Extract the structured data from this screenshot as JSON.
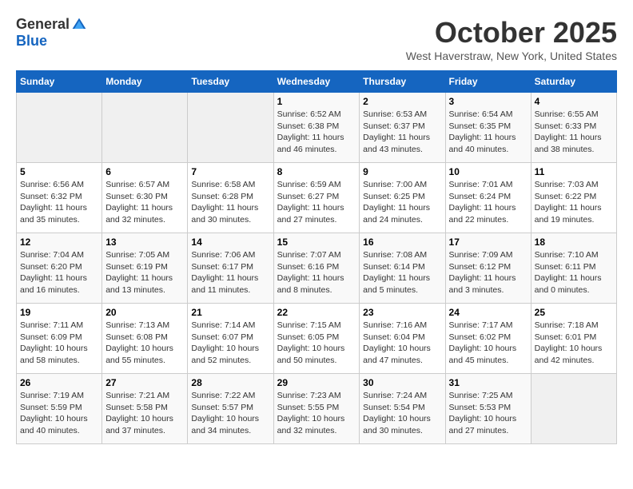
{
  "logo": {
    "general": "General",
    "blue": "Blue"
  },
  "title": "October 2025",
  "location": "West Haverstraw, New York, United States",
  "weekdays": [
    "Sunday",
    "Monday",
    "Tuesday",
    "Wednesday",
    "Thursday",
    "Friday",
    "Saturday"
  ],
  "weeks": [
    [
      {
        "day": "",
        "info": ""
      },
      {
        "day": "",
        "info": ""
      },
      {
        "day": "",
        "info": ""
      },
      {
        "day": "1",
        "info": "Sunrise: 6:52 AM\nSunset: 6:38 PM\nDaylight: 11 hours and 46 minutes."
      },
      {
        "day": "2",
        "info": "Sunrise: 6:53 AM\nSunset: 6:37 PM\nDaylight: 11 hours and 43 minutes."
      },
      {
        "day": "3",
        "info": "Sunrise: 6:54 AM\nSunset: 6:35 PM\nDaylight: 11 hours and 40 minutes."
      },
      {
        "day": "4",
        "info": "Sunrise: 6:55 AM\nSunset: 6:33 PM\nDaylight: 11 hours and 38 minutes."
      }
    ],
    [
      {
        "day": "5",
        "info": "Sunrise: 6:56 AM\nSunset: 6:32 PM\nDaylight: 11 hours and 35 minutes."
      },
      {
        "day": "6",
        "info": "Sunrise: 6:57 AM\nSunset: 6:30 PM\nDaylight: 11 hours and 32 minutes."
      },
      {
        "day": "7",
        "info": "Sunrise: 6:58 AM\nSunset: 6:28 PM\nDaylight: 11 hours and 30 minutes."
      },
      {
        "day": "8",
        "info": "Sunrise: 6:59 AM\nSunset: 6:27 PM\nDaylight: 11 hours and 27 minutes."
      },
      {
        "day": "9",
        "info": "Sunrise: 7:00 AM\nSunset: 6:25 PM\nDaylight: 11 hours and 24 minutes."
      },
      {
        "day": "10",
        "info": "Sunrise: 7:01 AM\nSunset: 6:24 PM\nDaylight: 11 hours and 22 minutes."
      },
      {
        "day": "11",
        "info": "Sunrise: 7:03 AM\nSunset: 6:22 PM\nDaylight: 11 hours and 19 minutes."
      }
    ],
    [
      {
        "day": "12",
        "info": "Sunrise: 7:04 AM\nSunset: 6:20 PM\nDaylight: 11 hours and 16 minutes."
      },
      {
        "day": "13",
        "info": "Sunrise: 7:05 AM\nSunset: 6:19 PM\nDaylight: 11 hours and 13 minutes."
      },
      {
        "day": "14",
        "info": "Sunrise: 7:06 AM\nSunset: 6:17 PM\nDaylight: 11 hours and 11 minutes."
      },
      {
        "day": "15",
        "info": "Sunrise: 7:07 AM\nSunset: 6:16 PM\nDaylight: 11 hours and 8 minutes."
      },
      {
        "day": "16",
        "info": "Sunrise: 7:08 AM\nSunset: 6:14 PM\nDaylight: 11 hours and 5 minutes."
      },
      {
        "day": "17",
        "info": "Sunrise: 7:09 AM\nSunset: 6:12 PM\nDaylight: 11 hours and 3 minutes."
      },
      {
        "day": "18",
        "info": "Sunrise: 7:10 AM\nSunset: 6:11 PM\nDaylight: 11 hours and 0 minutes."
      }
    ],
    [
      {
        "day": "19",
        "info": "Sunrise: 7:11 AM\nSunset: 6:09 PM\nDaylight: 10 hours and 58 minutes."
      },
      {
        "day": "20",
        "info": "Sunrise: 7:13 AM\nSunset: 6:08 PM\nDaylight: 10 hours and 55 minutes."
      },
      {
        "day": "21",
        "info": "Sunrise: 7:14 AM\nSunset: 6:07 PM\nDaylight: 10 hours and 52 minutes."
      },
      {
        "day": "22",
        "info": "Sunrise: 7:15 AM\nSunset: 6:05 PM\nDaylight: 10 hours and 50 minutes."
      },
      {
        "day": "23",
        "info": "Sunrise: 7:16 AM\nSunset: 6:04 PM\nDaylight: 10 hours and 47 minutes."
      },
      {
        "day": "24",
        "info": "Sunrise: 7:17 AM\nSunset: 6:02 PM\nDaylight: 10 hours and 45 minutes."
      },
      {
        "day": "25",
        "info": "Sunrise: 7:18 AM\nSunset: 6:01 PM\nDaylight: 10 hours and 42 minutes."
      }
    ],
    [
      {
        "day": "26",
        "info": "Sunrise: 7:19 AM\nSunset: 5:59 PM\nDaylight: 10 hours and 40 minutes."
      },
      {
        "day": "27",
        "info": "Sunrise: 7:21 AM\nSunset: 5:58 PM\nDaylight: 10 hours and 37 minutes."
      },
      {
        "day": "28",
        "info": "Sunrise: 7:22 AM\nSunset: 5:57 PM\nDaylight: 10 hours and 34 minutes."
      },
      {
        "day": "29",
        "info": "Sunrise: 7:23 AM\nSunset: 5:55 PM\nDaylight: 10 hours and 32 minutes."
      },
      {
        "day": "30",
        "info": "Sunrise: 7:24 AM\nSunset: 5:54 PM\nDaylight: 10 hours and 30 minutes."
      },
      {
        "day": "31",
        "info": "Sunrise: 7:25 AM\nSunset: 5:53 PM\nDaylight: 10 hours and 27 minutes."
      },
      {
        "day": "",
        "info": ""
      }
    ]
  ]
}
